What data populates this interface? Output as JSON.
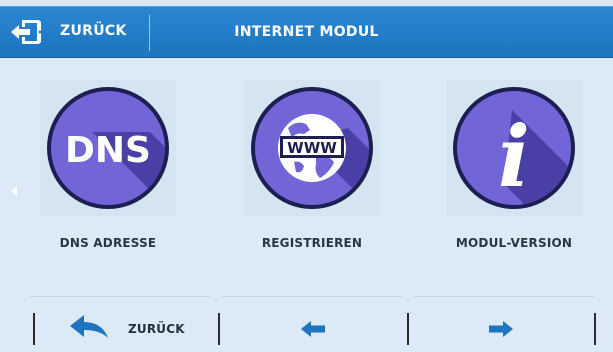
{
  "header": {
    "back_label": "ZURÜCK",
    "title": "INTERNET MODUL"
  },
  "tiles": [
    {
      "label": "DNS ADRESSE",
      "icon": "dns-icon",
      "icon_text": "DNS"
    },
    {
      "label": "REGISTRIEREN",
      "icon": "globe-www-icon",
      "icon_text": "WWW"
    },
    {
      "label": "MODUL-VERSION",
      "icon": "info-icon",
      "icon_text": "i"
    }
  ],
  "footer": {
    "back_label": "ZURÜCK",
    "prev_icon": "arrow-left-icon",
    "next_icon": "arrow-right-icon"
  },
  "colors": {
    "header": "#1e74bf",
    "circle": "#7265d8",
    "circle_ring": "#1c1f52",
    "shadow": "#4a3fa6",
    "arrow": "#1e74bf",
    "background": "#dbeaf6"
  }
}
